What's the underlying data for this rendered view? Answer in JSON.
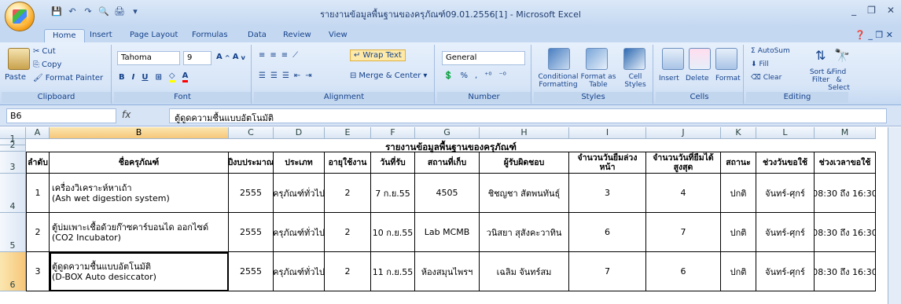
{
  "window": {
    "title": "รายงานข้อมูลพื้นฐานของครุภัณฑ์09.01.2556[1] - Microsoft Excel",
    "controls": [
      "_",
      "❐",
      "✕"
    ]
  },
  "qat": [
    "💾",
    "↶",
    "↷",
    "🔍",
    "🖨",
    "▾"
  ],
  "tabs": [
    "Home",
    "Insert",
    "Page Layout",
    "Formulas",
    "Data",
    "Review",
    "View"
  ],
  "ribbon_right": "❓ _ ❐ ✕",
  "ribbon": {
    "clipboard": {
      "paste": "Paste",
      "cut": "Cut",
      "copy": "Copy",
      "format_painter": "Format Painter",
      "label": "Clipboard"
    },
    "font": {
      "name": "Tahoma",
      "size": "9",
      "label": "Font"
    },
    "alignment": {
      "wrap": "Wrap Text",
      "merge": "Merge & Center",
      "label": "Alignment"
    },
    "number": {
      "format": "General",
      "pct": "%",
      "comma": ",",
      "label": "Number"
    },
    "styles": {
      "conditional": "Conditional Formatting",
      "format_table": "Format as Table",
      "cell_styles": "Cell Styles",
      "label": "Styles"
    },
    "cells": {
      "insert": "Insert",
      "delete": "Delete",
      "format": "Format",
      "label": "Cells"
    },
    "editing": {
      "autosum": "AutoSum",
      "fill": "Fill",
      "clear": "Clear",
      "sort": "Sort & Filter",
      "find": "Find & Select",
      "label": "Editing"
    }
  },
  "formula_bar": {
    "name_box": "B6",
    "fx": "fx",
    "content": "ตู้ดูดความชื้นแบบอัตโนมัติ"
  },
  "columns": [
    "A",
    "B",
    "C",
    "D",
    "E",
    "F",
    "G",
    "H",
    "I",
    "J",
    "K",
    "L",
    "M"
  ],
  "rows": [
    "1",
    "2",
    "3",
    "4",
    "5",
    "6"
  ],
  "sheet": {
    "title": "รายงานข้อมูลพื้นฐานของครุภัณฑ์",
    "headers": [
      "ลำดับ",
      "ชื่อครุภัณฑ์",
      "ปีงบประมาณ",
      "ประเภท",
      "อายุใช้งาน",
      "วันที่รับ",
      "สถานที่เก็บ",
      "ผู้รับผิดชอบ",
      "จำนวนวันยืมล่วงหน้า",
      "จำนวนวันที่ยืมได้สูงสุด",
      "สถานะ",
      "ช่วงวันขอใช้",
      "ช่วงเวลาขอใช้"
    ],
    "rows": [
      [
        "1",
        "เครื่องวิเคราะห์หาเถ้า\n(Ash wet digestion system)",
        "2555",
        "ครุภัณฑ์ทั่วไป",
        "2",
        "7 ก.ย.55",
        "4505",
        "ชิชญชา สัตพนทันธุ์",
        "3",
        "4",
        "ปกติ",
        "จันทร์-ศุกร์",
        "08:30 ถึง 16:30"
      ],
      [
        "2",
        "ตู้บ่มเพาะเชื้อด้วยก๊าซคาร์บอนได ออกไซด์\n(CO2 Incubator)",
        "2555",
        "ครุภัณฑ์ทั่วไป",
        "2",
        "10 ก.ย.55",
        "Lab MCMB",
        "วนิสยา สุสังคะวาทิน",
        "6",
        "7",
        "ปกติ",
        "จันทร์-ศุกร์",
        "08:30 ถึง 16:30"
      ],
      [
        "3",
        "ตู้ดูดความชื้นแบบอัตโนมัติ\n(D-BOX Auto desiccator)",
        "2555",
        "ครุภัณฑ์ทั่วไป",
        "2",
        "11 ก.ย.55",
        "ห้องสมุนไพรฯ",
        "เฉลิม จันทร์สม",
        "7",
        "6",
        "ปกติ",
        "จันทร์-ศุกร์",
        "08:30 ถึง 16:30"
      ]
    ]
  }
}
